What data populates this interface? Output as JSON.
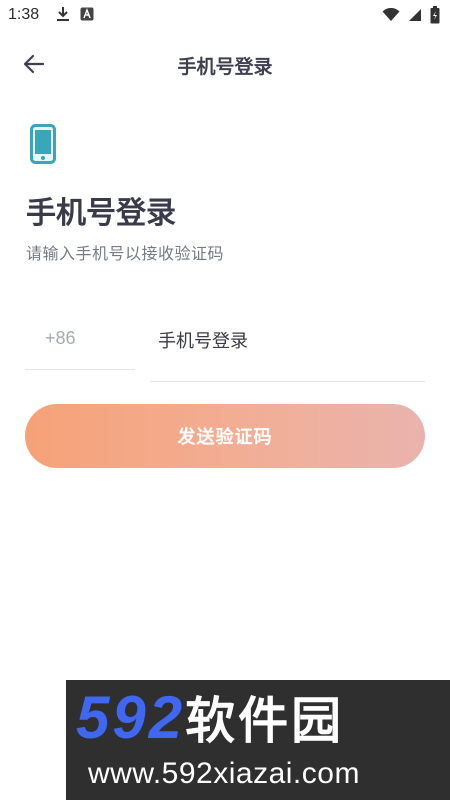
{
  "status": {
    "time": "1:38"
  },
  "toolbar": {
    "title": "手机号登录"
  },
  "main": {
    "headline": "手机号登录",
    "subtitle": "请输入手机号以接收验证码",
    "country_code": "+86",
    "phone_placeholder": "手机号登录",
    "send_button": "发送验证码"
  },
  "watermark": {
    "number": "592",
    "chinese": "软件园",
    "url": "www.592xiazai.com"
  },
  "icons": {
    "back": "back-arrow-icon",
    "phone": "smartphone-icon",
    "download": "download-icon",
    "wifi": "wifi-icon",
    "signal": "signal-icon",
    "battery": "battery-icon"
  },
  "colors": {
    "button_start": "#f6a277",
    "button_end": "#e9b3ad",
    "phone_icon": "#3aa6b9",
    "watermark_blue": "#3f67f0"
  }
}
